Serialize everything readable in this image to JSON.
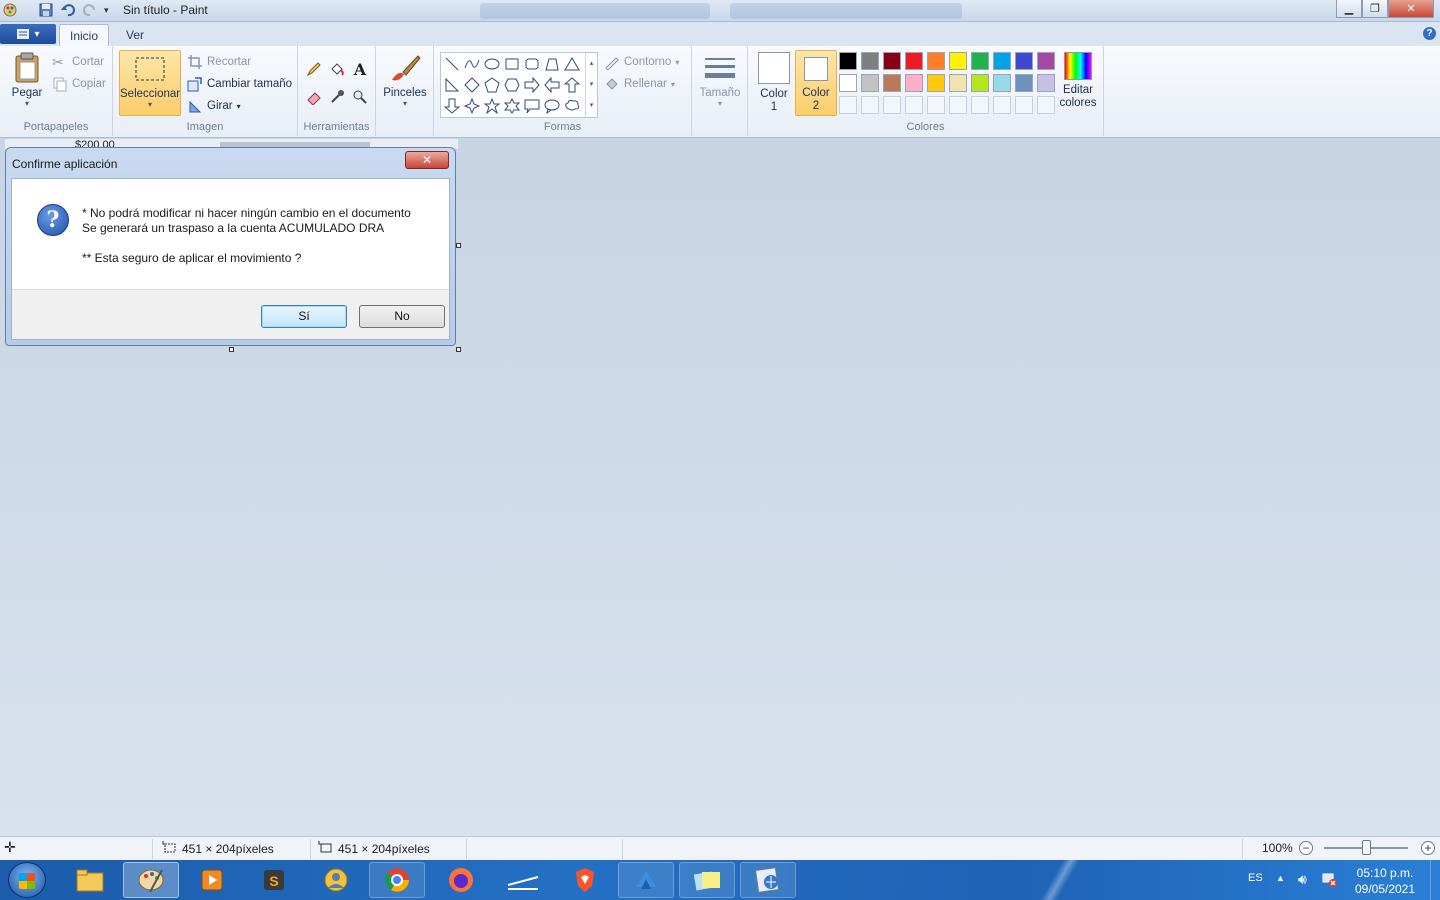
{
  "window": {
    "title": "Sin título - Paint"
  },
  "tabs": [
    {
      "label": "Inicio",
      "active": true
    },
    {
      "label": "Ver",
      "active": false
    }
  ],
  "ribbon": {
    "clipboard": {
      "group_label": "Portapapeles",
      "paste": "Pegar",
      "cut": "Cortar",
      "copy": "Copiar"
    },
    "image": {
      "group_label": "Imagen",
      "select": "Seleccionar",
      "crop": "Recortar",
      "resize": "Cambiar tamaño",
      "rotate": "Girar"
    },
    "tools": {
      "group_label": "Herramientas"
    },
    "brushes": {
      "label": "Pinceles"
    },
    "shapes": {
      "group_label": "Formas",
      "outline": "Contorno",
      "fill": "Rellenar"
    },
    "size": {
      "label": "Tamaño"
    },
    "colors": {
      "group_label": "Colores",
      "color1_a": "Color",
      "color1_b": "1",
      "color2_a": "Color",
      "color2_b": "2",
      "edit_a": "Editar",
      "edit_b": "colores",
      "palette_row1": [
        "#000000",
        "#7f7f7f",
        "#880015",
        "#ed1c24",
        "#ff7f27",
        "#fff200",
        "#22b14c",
        "#00a2e8",
        "#3f48cc",
        "#a349a4"
      ],
      "palette_row2": [
        "#ffffff",
        "#c3c3c3",
        "#b97a57",
        "#ffaec9",
        "#ffc90e",
        "#efe4b0",
        "#b5e61d",
        "#99d9ea",
        "#7092be",
        "#c8bfe7"
      ]
    }
  },
  "canvas_peek": {
    "amount": "$200.00"
  },
  "dialog": {
    "title": "Confirme aplicación",
    "close_glyph": "✕",
    "line1": "* No podrá modificar ni hacer ningún cambio en el documento",
    "line2": "Se generará un traspaso a la cuenta ACUMULADO DRA",
    "line3": "** Esta seguro de aplicar el movimiento ?",
    "yes_label": "Sí",
    "no_label": "No"
  },
  "status": {
    "selection_size": "451 × 204píxeles",
    "image_size": "451 × 204píxeles",
    "zoom": "100%"
  },
  "tray": {
    "language": "ES",
    "time": "05:10 p.m.",
    "date": "09/05/2021"
  }
}
